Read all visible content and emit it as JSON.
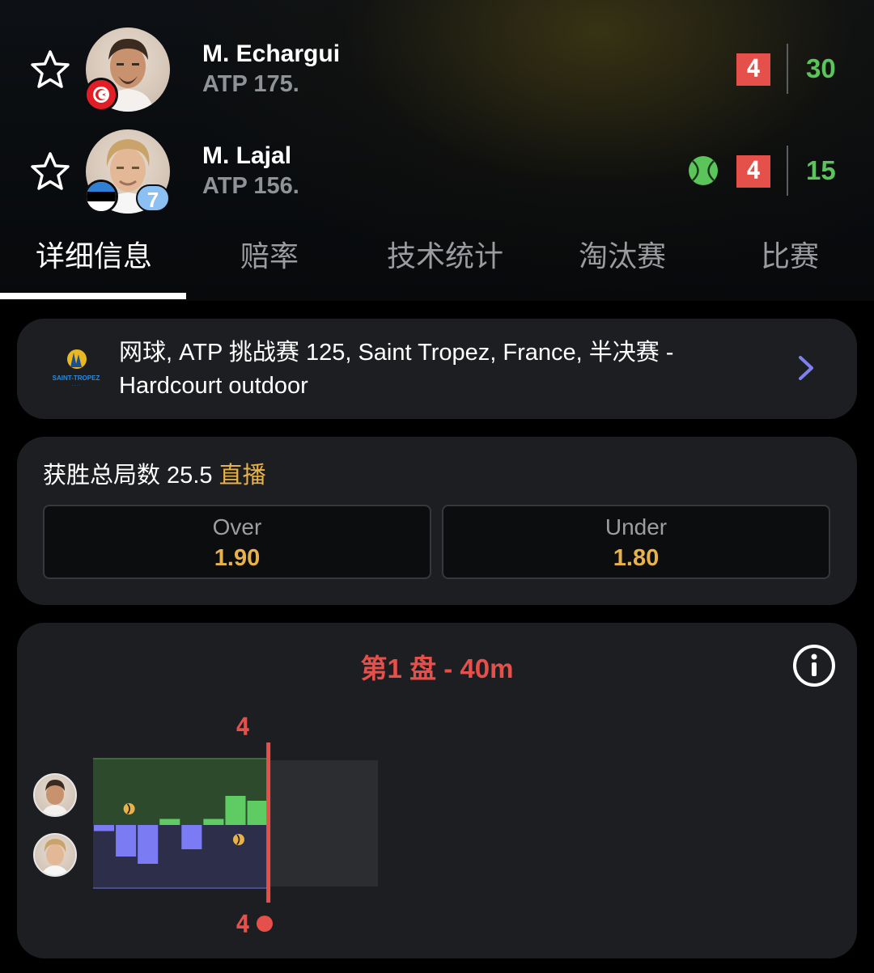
{
  "players": [
    {
      "name": "M. Echargui",
      "rank": "ATP 175.",
      "games": "4",
      "points": "30",
      "serving": false,
      "flag": "tunisia-flag",
      "seed": ""
    },
    {
      "name": "M. Lajal",
      "rank": "ATP 156.",
      "games": "4",
      "points": "15",
      "serving": true,
      "flag": "estonia-flag",
      "seed": "7"
    }
  ],
  "tabs": [
    {
      "label": "详细信息",
      "active": true
    },
    {
      "label": "赔率",
      "active": false
    },
    {
      "label": "技术统计",
      "active": false
    },
    {
      "label": "淘汰赛",
      "active": false
    },
    {
      "label": "比赛",
      "active": false
    }
  ],
  "tournament": {
    "line1": "网球, ATP 挑战赛 125, Saint Tropez, France, 半决赛 -",
    "line2": "Hardcourt outdoor",
    "logo_text": "SAINT-TROPEZ"
  },
  "odds": {
    "title": "获胜总局数 25.5",
    "live_label": "直播",
    "options": [
      {
        "label": "Over",
        "value": "1.90"
      },
      {
        "label": "Under",
        "value": "1.80"
      }
    ]
  },
  "momentum": {
    "title": "第1 盘 - 40m",
    "top_marker": "4",
    "bottom_marker": "4",
    "chart_data": {
      "type": "bar",
      "games": [
        1,
        2,
        3,
        4,
        5,
        6,
        7,
        8
      ],
      "series": [
        {
          "name": "M. Echargui",
          "values": [
            0,
            0,
            0,
            0.25,
            0,
            0.25,
            1.2,
            1.0
          ]
        },
        {
          "name": "M. Lajal",
          "values": [
            0.25,
            1.3,
            1.6,
            0,
            1.0,
            0,
            0,
            0
          ]
        }
      ],
      "break_markers": [
        {
          "player": "M. Echargui",
          "game": 2
        },
        {
          "player": "M. Lajal",
          "game": 7
        }
      ]
    }
  },
  "colors": {
    "accent_red": "#e5504b",
    "point_green": "#5bc45a",
    "odds_gold": "#e8b24b",
    "p1_bar": "#5fcb63",
    "p2_bar": "#7b7cf4"
  }
}
